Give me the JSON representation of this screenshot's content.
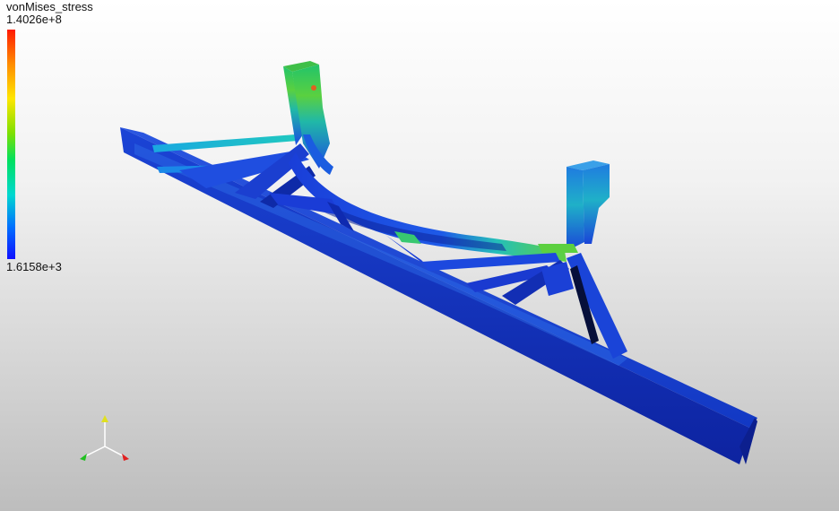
{
  "legend": {
    "title": "vonMises_stress",
    "max_label": "1.4026e+8",
    "min_label": "1.6158e+3",
    "colors": [
      "#ff1a00",
      "#ff8c00",
      "#ffe600",
      "#7fe000",
      "#00e060",
      "#00d8d0",
      "#0070ff",
      "#1010ff"
    ]
  },
  "axes": {
    "x_color": "#e02020",
    "y_color": "#e0e020",
    "z_color": "#20c020"
  },
  "background": {
    "top": "#ffffff",
    "bottom": "#bdbdbd"
  }
}
